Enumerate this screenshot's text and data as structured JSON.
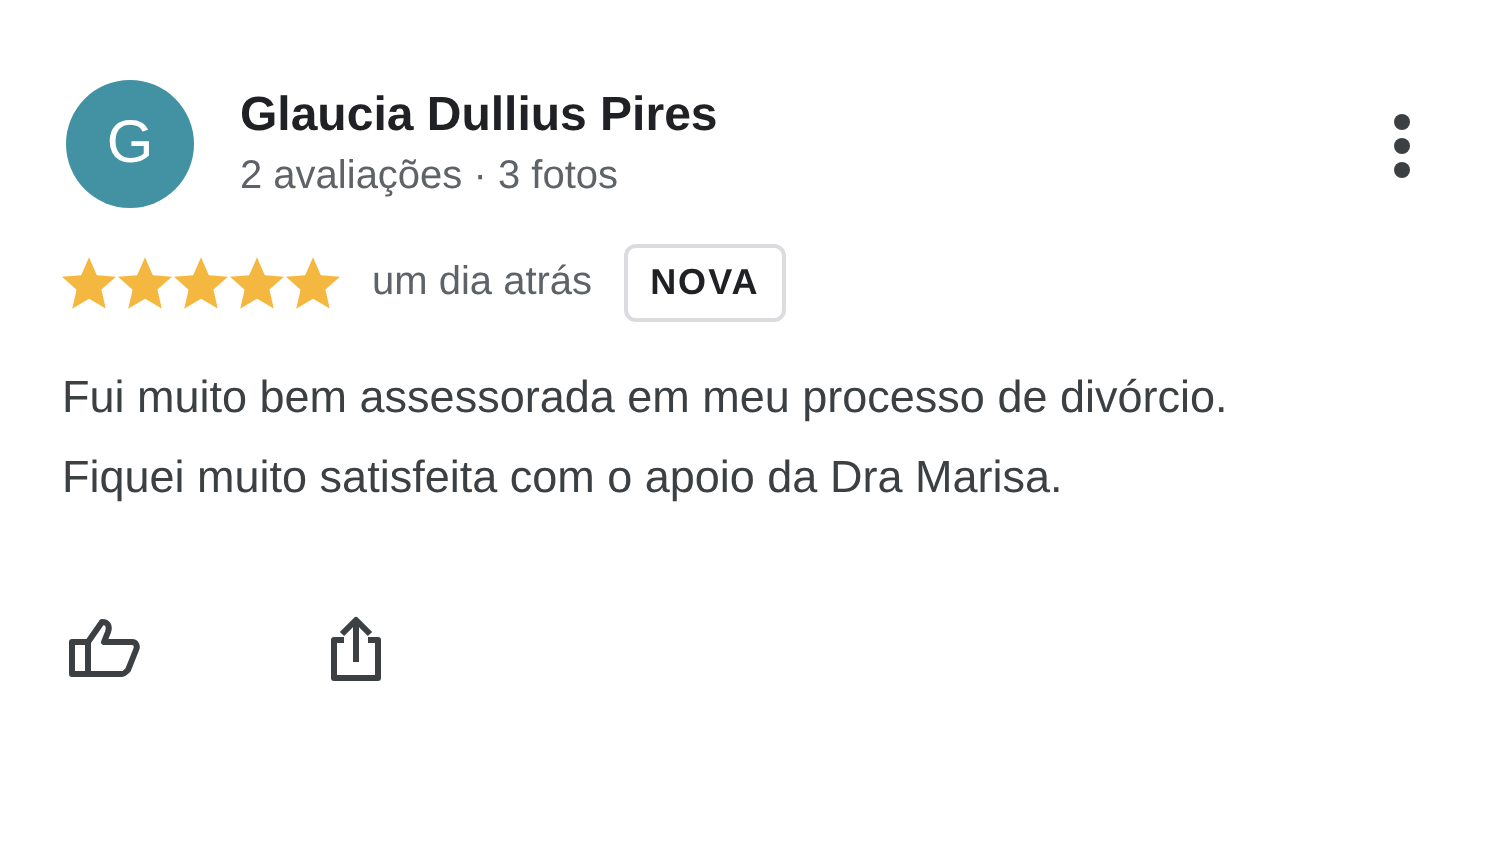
{
  "review": {
    "author": {
      "initial": "G",
      "name": "Glaucia Dullius Pires",
      "color": "#4292a3"
    },
    "author_stats": "2 avaliações · 3 fotos",
    "stars": 5,
    "time": "um dia atrás",
    "badge": "NOVA",
    "text": "Fui muito bem assessorada em meu processo de divórcio. Fiquei muito satisfeita com o apoio da Dra Marisa."
  }
}
